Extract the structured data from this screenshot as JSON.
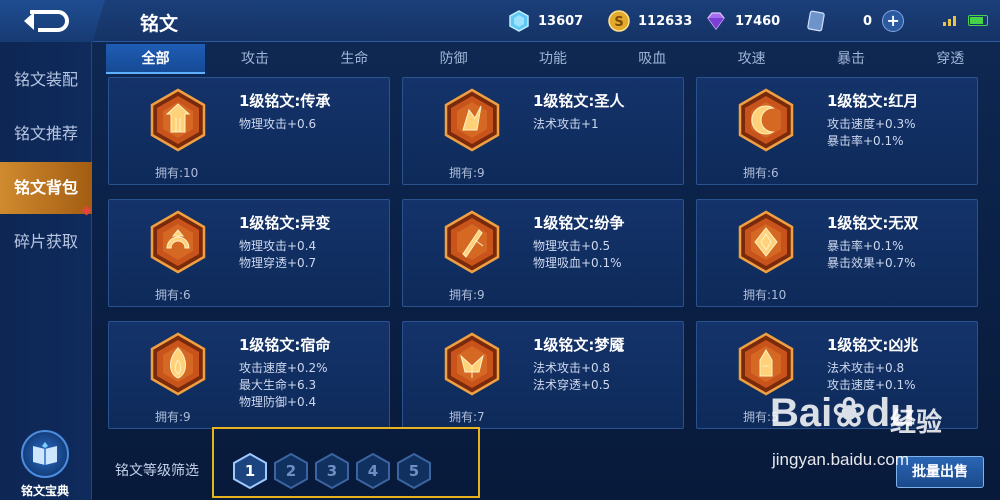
{
  "header": {
    "title": "铭文",
    "resources": [
      {
        "icon": "diamond-icon",
        "value": "13607"
      },
      {
        "icon": "gold-coin-icon",
        "value": "112633"
      },
      {
        "icon": "gem-icon",
        "value": "17460"
      },
      {
        "icon": "card-icon",
        "value": "0"
      }
    ],
    "add_label": "+"
  },
  "tabs": [
    {
      "label": "全部"
    },
    {
      "label": "攻击"
    },
    {
      "label": "生命"
    },
    {
      "label": "防御"
    },
    {
      "label": "功能"
    },
    {
      "label": "吸血"
    },
    {
      "label": "攻速"
    },
    {
      "label": "暴击"
    },
    {
      "label": "穿透"
    }
  ],
  "active_tab": 0,
  "sidebar": {
    "items": [
      {
        "label": "铭文装配"
      },
      {
        "label": "铭文推荐"
      },
      {
        "label": "铭文背包"
      },
      {
        "label": "碎片获取"
      }
    ],
    "active_index": 2,
    "codex_label": "铭文宝典"
  },
  "cards": [
    {
      "name": "1级铭文:传承",
      "attrs": [
        "物理攻击+0.6"
      ],
      "owned": "拥有:10",
      "icon": "pillar-icon"
    },
    {
      "name": "1级铭文:圣人",
      "attrs": [
        "法术攻击+1"
      ],
      "owned": "拥有:9",
      "icon": "sage-icon"
    },
    {
      "name": "1级铭文:红月",
      "attrs": [
        "攻击速度+0.3%",
        "暴击率+0.1%"
      ],
      "owned": "拥有:6",
      "icon": "crescent-moon-icon"
    },
    {
      "name": "1级铭文:异变",
      "attrs": [
        "物理攻击+0.4",
        "物理穿透+0.7"
      ],
      "owned": "拥有:6",
      "icon": "mutation-icon"
    },
    {
      "name": "1级铭文:纷争",
      "attrs": [
        "物理攻击+0.5",
        "物理吸血+0.1%"
      ],
      "owned": "拥有:9",
      "icon": "sword-icon"
    },
    {
      "name": "1级铭文:无双",
      "attrs": [
        "暴击率+0.1%",
        "暴击效果+0.7%"
      ],
      "owned": "拥有:10",
      "icon": "diamond-rune-icon"
    },
    {
      "name": "1级铭文:宿命",
      "attrs": [
        "攻击速度+0.2%",
        "最大生命+6.3",
        "物理防御+0.4"
      ],
      "owned": "拥有:9",
      "icon": "flame-icon"
    },
    {
      "name": "1级铭文:梦魇",
      "attrs": [
        "法术攻击+0.8",
        "法术穿透+0.5"
      ],
      "owned": "拥有:7",
      "icon": "nightmare-icon"
    },
    {
      "name": "1级铭文:凶兆",
      "attrs": [
        "法术攻击+0.8",
        "攻击速度+0.1%"
      ],
      "owned": "拥有:5",
      "icon": "omen-icon"
    }
  ],
  "filter": {
    "label": "铭文等级筛选",
    "levels": [
      "1",
      "2",
      "3",
      "4",
      "5"
    ],
    "active_level": 0
  },
  "sell_button": "批量出售",
  "watermark": {
    "brand": "Bai",
    "brand_tail": "du",
    "cn": "经验",
    "url": "jingyan.baidu.com"
  },
  "colors": {
    "accent": "#d08a2f",
    "highlight_box": "#e6b21e",
    "emblem": "#c8541c"
  }
}
